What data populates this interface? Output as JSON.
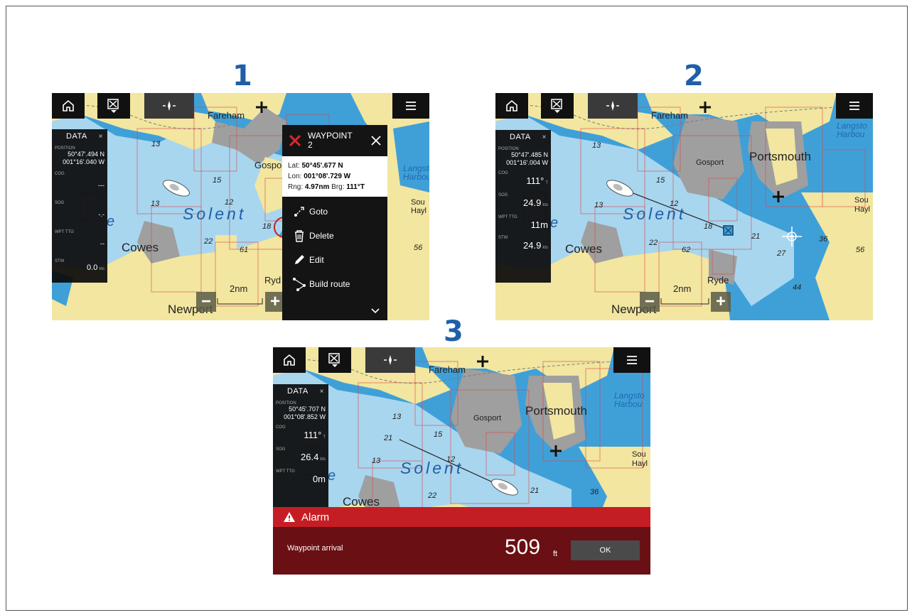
{
  "steps": [
    "1",
    "2",
    "3"
  ],
  "map_labels": {
    "fareham": "Fareham",
    "gosport": "Gosport",
    "gospo": "Gospo",
    "portsmouth": "Portsmouth",
    "cowes": "Cowes",
    "newport": "Newport",
    "ryde": "Ryde",
    "ryd": "Ryd",
    "solent": "Solent",
    "langstone": "Langsto",
    "harbour": "Harbou",
    "south_hayling_a": "Sou",
    "south_hayling_b": "Hayl",
    "e_char": "e",
    "depths_1": [
      "13",
      "15",
      "12",
      "13",
      "22",
      "61",
      "18",
      "56"
    ],
    "depths_2": [
      "13",
      "15",
      "12",
      "13",
      "22",
      "62",
      "18",
      "21",
      "27",
      "36",
      "56",
      "44"
    ],
    "depths_3": [
      "13",
      "21",
      "15",
      "12",
      "13",
      "22",
      "21",
      "36"
    ]
  },
  "scale_label": "2nm",
  "data_panel": {
    "title": "DATA",
    "close": "×",
    "labels": {
      "position": "POSITION",
      "cog": "COG",
      "sog": "SOG",
      "wpt_ttg": "WPT TTG",
      "stw": "STW"
    },
    "screen1": {
      "lat": "50°47'.494 N",
      "lon": "001°16'.040 W",
      "cog": "---",
      "sog": "-.-",
      "wpt_ttg": "--",
      "stw": "0.0",
      "stw_unit": "kts"
    },
    "screen2": {
      "lat": "50°47'.485 N",
      "lon": "001°16'.004 W",
      "cog": "111°",
      "cog_unit": "T",
      "sog": "24.9",
      "sog_unit": "kts",
      "wpt_ttg": "11m",
      "stw": "24.9",
      "stw_unit": "kts"
    },
    "screen3": {
      "lat": "50°45'.707 N",
      "lon": "001°08'.852 W",
      "cog": "111°",
      "cog_unit": "T",
      "sog": "26.4",
      "sog_unit": "kts",
      "wpt_ttg": "0m"
    }
  },
  "waypoint_menu": {
    "title_line1": "WAYPOINT",
    "title_line2": "2",
    "lat_label": "Lat:",
    "lat": "50°45'.677 N",
    "lon_label": "Lon:",
    "lon": "001°08'.729 W",
    "rng_label": "Rng:",
    "rng": "4.97nm",
    "brg_label": "Brg:",
    "brg": "111°T",
    "items": [
      "Goto",
      "Delete",
      "Edit",
      "Build route"
    ]
  },
  "alarm": {
    "title": "Alarm",
    "message": "Waypoint arrival",
    "distance": "509",
    "unit": "ft",
    "ok": "OK"
  },
  "colors": {
    "step_number": "#1f5fa8",
    "deep_water": "#3fa0d8",
    "shallow_water": "#a8d6ef",
    "land": "#f2e6a0",
    "urban": "#9f9f9f",
    "alarm_red": "#c41e24",
    "alarm_dark": "#6a0f13"
  }
}
